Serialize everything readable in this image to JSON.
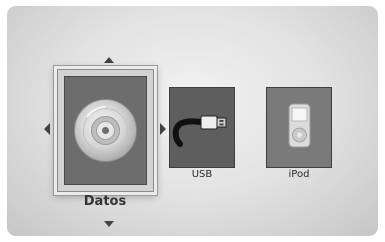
{
  "menu": {
    "items": [
      {
        "label": "Datos",
        "icon": "disc-icon",
        "selected": true
      },
      {
        "label": "USB",
        "icon": "usb-icon",
        "selected": false
      },
      {
        "label": "iPod",
        "icon": "ipod-icon",
        "selected": false
      }
    ],
    "navigation_arrows": [
      "up",
      "down",
      "left",
      "right"
    ]
  },
  "colors": {
    "background_center": "#f2f2f2",
    "background_edge": "#c6c6c6",
    "tile": "#5e5e5e",
    "tile_ipod": "#7a7a7a",
    "text": "#2a2a2a"
  }
}
